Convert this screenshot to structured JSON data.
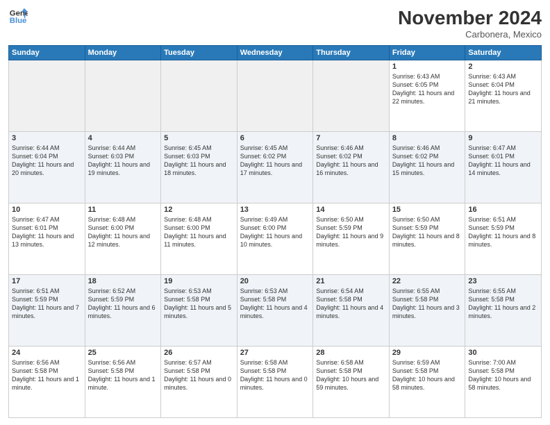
{
  "header": {
    "logo_line1": "General",
    "logo_line2": "Blue",
    "month": "November 2024",
    "location": "Carbonera, Mexico"
  },
  "days_of_week": [
    "Sunday",
    "Monday",
    "Tuesday",
    "Wednesday",
    "Thursday",
    "Friday",
    "Saturday"
  ],
  "weeks": [
    [
      {
        "day": "",
        "info": ""
      },
      {
        "day": "",
        "info": ""
      },
      {
        "day": "",
        "info": ""
      },
      {
        "day": "",
        "info": ""
      },
      {
        "day": "",
        "info": ""
      },
      {
        "day": "1",
        "info": "Sunrise: 6:43 AM\nSunset: 6:05 PM\nDaylight: 11 hours\nand 22 minutes."
      },
      {
        "day": "2",
        "info": "Sunrise: 6:43 AM\nSunset: 6:04 PM\nDaylight: 11 hours\nand 21 minutes."
      }
    ],
    [
      {
        "day": "3",
        "info": "Sunrise: 6:44 AM\nSunset: 6:04 PM\nDaylight: 11 hours\nand 20 minutes."
      },
      {
        "day": "4",
        "info": "Sunrise: 6:44 AM\nSunset: 6:03 PM\nDaylight: 11 hours\nand 19 minutes."
      },
      {
        "day": "5",
        "info": "Sunrise: 6:45 AM\nSunset: 6:03 PM\nDaylight: 11 hours\nand 18 minutes."
      },
      {
        "day": "6",
        "info": "Sunrise: 6:45 AM\nSunset: 6:02 PM\nDaylight: 11 hours\nand 17 minutes."
      },
      {
        "day": "7",
        "info": "Sunrise: 6:46 AM\nSunset: 6:02 PM\nDaylight: 11 hours\nand 16 minutes."
      },
      {
        "day": "8",
        "info": "Sunrise: 6:46 AM\nSunset: 6:02 PM\nDaylight: 11 hours\nand 15 minutes."
      },
      {
        "day": "9",
        "info": "Sunrise: 6:47 AM\nSunset: 6:01 PM\nDaylight: 11 hours\nand 14 minutes."
      }
    ],
    [
      {
        "day": "10",
        "info": "Sunrise: 6:47 AM\nSunset: 6:01 PM\nDaylight: 11 hours\nand 13 minutes."
      },
      {
        "day": "11",
        "info": "Sunrise: 6:48 AM\nSunset: 6:00 PM\nDaylight: 11 hours\nand 12 minutes."
      },
      {
        "day": "12",
        "info": "Sunrise: 6:48 AM\nSunset: 6:00 PM\nDaylight: 11 hours\nand 11 minutes."
      },
      {
        "day": "13",
        "info": "Sunrise: 6:49 AM\nSunset: 6:00 PM\nDaylight: 11 hours\nand 10 minutes."
      },
      {
        "day": "14",
        "info": "Sunrise: 6:50 AM\nSunset: 5:59 PM\nDaylight: 11 hours\nand 9 minutes."
      },
      {
        "day": "15",
        "info": "Sunrise: 6:50 AM\nSunset: 5:59 PM\nDaylight: 11 hours\nand 8 minutes."
      },
      {
        "day": "16",
        "info": "Sunrise: 6:51 AM\nSunset: 5:59 PM\nDaylight: 11 hours\nand 8 minutes."
      }
    ],
    [
      {
        "day": "17",
        "info": "Sunrise: 6:51 AM\nSunset: 5:59 PM\nDaylight: 11 hours\nand 7 minutes."
      },
      {
        "day": "18",
        "info": "Sunrise: 6:52 AM\nSunset: 5:59 PM\nDaylight: 11 hours\nand 6 minutes."
      },
      {
        "day": "19",
        "info": "Sunrise: 6:53 AM\nSunset: 5:58 PM\nDaylight: 11 hours\nand 5 minutes."
      },
      {
        "day": "20",
        "info": "Sunrise: 6:53 AM\nSunset: 5:58 PM\nDaylight: 11 hours\nand 4 minutes."
      },
      {
        "day": "21",
        "info": "Sunrise: 6:54 AM\nSunset: 5:58 PM\nDaylight: 11 hours\nand 4 minutes."
      },
      {
        "day": "22",
        "info": "Sunrise: 6:55 AM\nSunset: 5:58 PM\nDaylight: 11 hours\nand 3 minutes."
      },
      {
        "day": "23",
        "info": "Sunrise: 6:55 AM\nSunset: 5:58 PM\nDaylight: 11 hours\nand 2 minutes."
      }
    ],
    [
      {
        "day": "24",
        "info": "Sunrise: 6:56 AM\nSunset: 5:58 PM\nDaylight: 11 hours\nand 1 minute."
      },
      {
        "day": "25",
        "info": "Sunrise: 6:56 AM\nSunset: 5:58 PM\nDaylight: 11 hours\nand 1 minute."
      },
      {
        "day": "26",
        "info": "Sunrise: 6:57 AM\nSunset: 5:58 PM\nDaylight: 11 hours\nand 0 minutes."
      },
      {
        "day": "27",
        "info": "Sunrise: 6:58 AM\nSunset: 5:58 PM\nDaylight: 11 hours\nand 0 minutes."
      },
      {
        "day": "28",
        "info": "Sunrise: 6:58 AM\nSunset: 5:58 PM\nDaylight: 10 hours\nand 59 minutes."
      },
      {
        "day": "29",
        "info": "Sunrise: 6:59 AM\nSunset: 5:58 PM\nDaylight: 10 hours\nand 58 minutes."
      },
      {
        "day": "30",
        "info": "Sunrise: 7:00 AM\nSunset: 5:58 PM\nDaylight: 10 hours\nand 58 minutes."
      }
    ]
  ]
}
